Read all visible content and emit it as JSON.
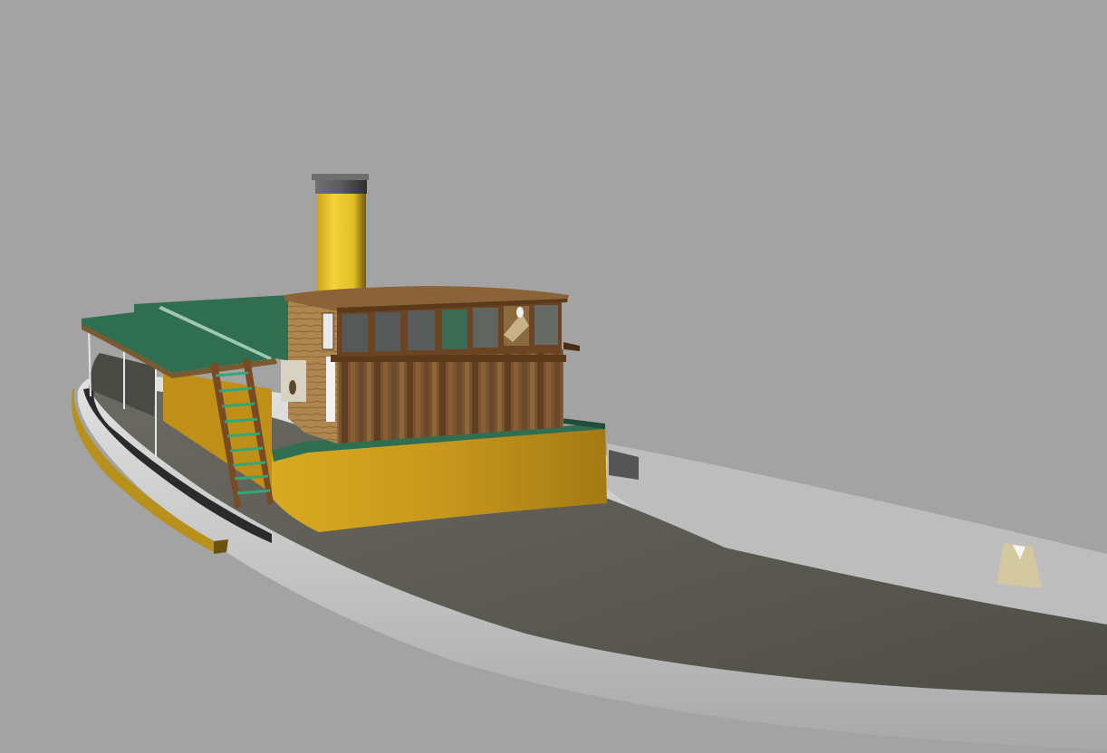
{
  "scene": {
    "subject": "3d-render-tugboat",
    "colors": {
      "background": "#a3a3a3",
      "hull_white": "#d4d4d4",
      "hull_shadow": "#8c8c8c",
      "deck": "#5d5d55",
      "deckhouse_yellow": "#c89a1c",
      "funnel_yellow": "#e8c52c",
      "funnel_cap": "#5a5a5a",
      "roof_green": "#2f6e50",
      "wood_dark": "#6b4424",
      "wood_light": "#b48a52",
      "rub_rail": "#b8901c"
    }
  }
}
